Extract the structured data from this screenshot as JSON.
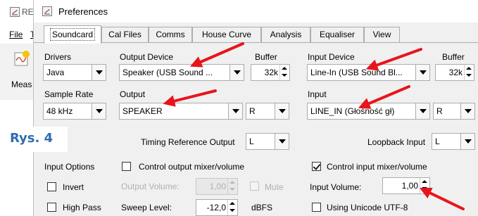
{
  "background_window": {
    "title_fragment": "RE",
    "menu_file": "File",
    "menu_next": "T",
    "toolbar_label": "Meas"
  },
  "window": {
    "title": "Preferences"
  },
  "tabs": [
    {
      "label": "Soundcard",
      "active": true
    },
    {
      "label": "Cal Files"
    },
    {
      "label": "Comms"
    },
    {
      "label": "House Curve"
    },
    {
      "label": "Analysis"
    },
    {
      "label": "Equaliser"
    },
    {
      "label": "View"
    }
  ],
  "soundcard": {
    "drivers_label": "Drivers",
    "drivers_value": "Java",
    "output_device_label": "Output Device",
    "output_device_value": "Speaker (USB Sound ...",
    "output_buffer_label": "Buffer",
    "output_buffer_value": "32k",
    "input_device_label": "Input Device",
    "input_device_value": "Line-In (USB Sound Bl...",
    "input_buffer_label": "Buffer",
    "input_buffer_value": "32k",
    "sample_rate_label": "Sample Rate",
    "sample_rate_value": "48 kHz",
    "output_label": "Output",
    "output_value": "SPEAKER",
    "output_channel_value": "R",
    "input_label": "Input",
    "input_value": "LINE_IN (Głośność gł)",
    "input_channel_value": "R",
    "timing_ref_label": "Timing Reference Output",
    "timing_ref_value": "L",
    "loopback_label": "Loopback Input",
    "loopback_value": "L",
    "input_options_label": "Input Options",
    "invert_label": "Invert",
    "invert_checked": false,
    "high_pass_label": "High Pass",
    "high_pass_checked": false,
    "control_output_label": "Control output mixer/volume",
    "control_output_checked": false,
    "output_volume_label": "Output Volume:",
    "output_volume_value": "1,00",
    "mute_label": "Mute",
    "mute_checked": false,
    "sweep_level_label": "Sweep Level:",
    "sweep_level_value": "-12,0",
    "sweep_level_unit": "dBFS",
    "control_input_label": "Control input mixer/volume",
    "control_input_checked": true,
    "input_volume_label": "Input Volume:",
    "input_volume_value": "1,00",
    "unicode_label": "Using Unicode UTF-8",
    "unicode_checked": false
  },
  "figure_label": "Rys. 4",
  "colors": {
    "annotation_arrow": "#e8141b",
    "figure_label": "#2f6db0",
    "panel_background": "#f0f0f0"
  }
}
